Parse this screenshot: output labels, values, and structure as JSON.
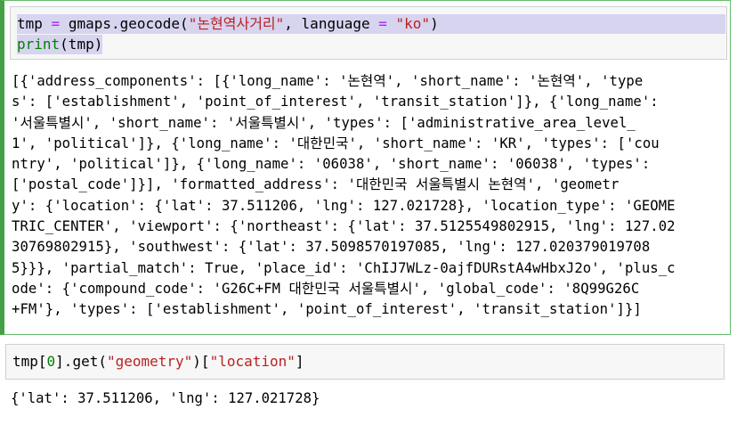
{
  "cell1": {
    "input": {
      "line1": {
        "var": "tmp",
        "eq": "=",
        "call": "gmaps.geocode(",
        "arg_string": "\"논현역사거리\"",
        "sep": ", language ",
        "eq2": "=",
        "space": " ",
        "lang_string": "\"ko\"",
        "close": ")"
      },
      "line2": {
        "func": "print",
        "args": "(tmp)"
      }
    },
    "output_lines": [
      "[{'address_components': [{'long_name': '논현역', 'short_name': '논현역', 'type",
      "s': ['establishment', 'point_of_interest', 'transit_station']}, {'long_name':",
      "'서울특별시', 'short_name': '서울특별시', 'types': ['administrative_area_level_",
      "1', 'political']}, {'long_name': '대한민국', 'short_name': 'KR', 'types': ['cou",
      "ntry', 'political']}, {'long_name': '06038', 'short_name': '06038', 'types':",
      "['postal_code']}], 'formatted_address': '대한민국 서울특별시 논현역', 'geometr",
      "y': {'location': {'lat': 37.511206, 'lng': 127.021728}, 'location_type': 'GEOME",
      "TRIC_CENTER', 'viewport': {'northeast': {'lat': 37.5125549802915, 'lng': 127.02",
      "30769802915}, 'southwest': {'lat': 37.5098570197085, 'lng': 127.020379019708",
      "5}}}, 'partial_match': True, 'place_id': 'ChIJ7WLz-0ajfDURstA4wHbxJ2o', 'plus_c",
      "ode': {'compound_code': 'G26C+FM 대한민국 서울특별시', 'global_code': '8Q99G26C",
      "+FM'}, 'types': ['establishment', 'point_of_interest', 'transit_station']}]"
    ]
  },
  "cell2": {
    "input": {
      "prefix": "tmp[",
      "index": "0",
      "mid": "].get(",
      "key1": "\"geometry\"",
      "mid2": ")[",
      "key2": "\"location\"",
      "close": "]"
    },
    "output": "{'lat': 37.511206, 'lng': 127.021728}"
  }
}
